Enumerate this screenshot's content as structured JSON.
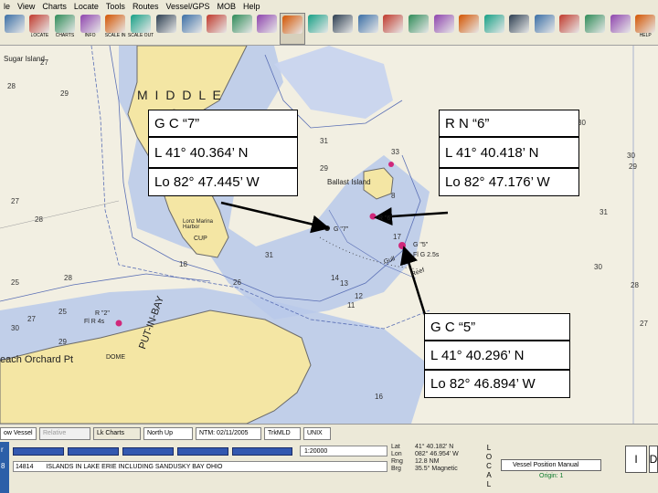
{
  "menu": {
    "items": [
      "le",
      "View",
      "Charts",
      "Locate",
      "Tools",
      "Routes",
      "Vessel/GPS",
      "MOB",
      "Help"
    ]
  },
  "toolbar": {
    "buttons": [
      {
        "label": "",
        "icon": "print-icon"
      },
      {
        "label": "LOCATE",
        "icon": "boat-icon"
      },
      {
        "label": "CHARTS",
        "icon": "chart-icon"
      },
      {
        "label": "INFO",
        "icon": "info-icon"
      },
      {
        "label": "SCALE IN",
        "icon": "zoom-in-icon"
      },
      {
        "label": "SCALE OUT",
        "icon": "zoom-out-icon"
      },
      {
        "label": "",
        "icon": "ruler-icon"
      },
      {
        "label": "",
        "icon": "route-icon"
      },
      {
        "label": "",
        "icon": "track-icon"
      },
      {
        "label": "",
        "icon": "layers-icon"
      },
      {
        "label": "",
        "icon": "mark-icon"
      },
      {
        "label": "",
        "icon": "hand-icon"
      },
      {
        "label": "",
        "icon": "flag-icon"
      },
      {
        "label": "",
        "icon": "measure-icon"
      },
      {
        "label": "",
        "icon": "wave-icon"
      },
      {
        "label": "",
        "icon": "star-icon"
      },
      {
        "label": "",
        "icon": "pointer-icon"
      },
      {
        "label": "",
        "icon": "target-icon"
      },
      {
        "label": "",
        "icon": "tide-icon"
      },
      {
        "label": "",
        "icon": "anchor-icon"
      },
      {
        "label": "",
        "icon": "gps-icon"
      },
      {
        "label": "",
        "icon": "zoom-icon"
      },
      {
        "label": "",
        "icon": "search-icon"
      },
      {
        "label": "",
        "icon": "mob-icon"
      },
      {
        "label": "",
        "icon": "tracker-icon"
      },
      {
        "label": "HELP",
        "icon": "help-icon"
      }
    ]
  },
  "chart": {
    "labels": {
      "middle": "M I D D L E",
      "sugar_island": "Sugar Island",
      "ballast_island": "Ballast Island",
      "lonz": "Lonz Marina Harbor",
      "cup": "CUP",
      "each_orchard": "each Orchard Pt",
      "g7": "G \"7\"",
      "r6": "R \"6\"",
      "g5": "G \"5\"",
      "fl25": "Fl G 2.5s",
      "reef": "Reef",
      "gull": "Gull",
      "put_in_bay": "PUT-IN-BAY",
      "r2": "R \"2\"",
      "fl4": "Fl R 4s",
      "dome": "DOME"
    },
    "depths": [
      "28",
      "27",
      "29",
      "33",
      "31",
      "30",
      "25",
      "28",
      "27",
      "28",
      "29",
      "30",
      "25",
      "27",
      "31",
      "31",
      "28",
      "29",
      "18",
      "26",
      "17",
      "8",
      "14",
      "13",
      "11",
      "12",
      "30",
      "28",
      "16",
      "27",
      "30",
      "29"
    ],
    "callouts": {
      "c1_name": "G C “7”",
      "c1_lat": "L 41° 40.364’ N",
      "c1_lon": "Lo 82° 47.445’ W",
      "c2_name": "R N “6”",
      "c2_lat": "L 41° 40.418’ N",
      "c2_lon": "Lo 82° 47.176’ W",
      "c3_name": "G C “5”",
      "c3_lat": "L 41° 40.296’ N",
      "c3_lon": "Lo 82° 46.894’ W"
    },
    "colors": {
      "land": "#f4e6a4",
      "shallow": "#b8c9ea",
      "water": "#f2efe2",
      "contour": "#5a6fb5",
      "callout_arrow": "#000000",
      "buoy_red": "#d0287a"
    }
  },
  "status": {
    "vessel_label": "ow Vessel",
    "relative_label": "Relative",
    "lock_charts": "Lk Charts",
    "orientation": "North Up",
    "ntm": "NTM: 02/11/2005",
    "tracking": "TrkMLD",
    "units": "UNIX"
  },
  "bottom": {
    "strip_left": "r",
    "strip_left2": "8",
    "code": "14814",
    "info": "ISLANDS IN LAKE ERIE INCLUDING SANDUSKY BAY OHIO",
    "scale": "1:20000",
    "lat_k": "Lat",
    "lat_v": "41° 40.182' N",
    "lon_k": "Lon",
    "lon_v": "082° 46.954' W",
    "rng_k": "Rng",
    "rng_v": "12.8 NM",
    "brg_k": "Brg",
    "brg_v": "35.5° Magnetic",
    "local": "L O C A L",
    "vessel_position": "Vessel Position Manual",
    "origin": "Origin: 1",
    "button1": "I",
    "button2": "D"
  }
}
